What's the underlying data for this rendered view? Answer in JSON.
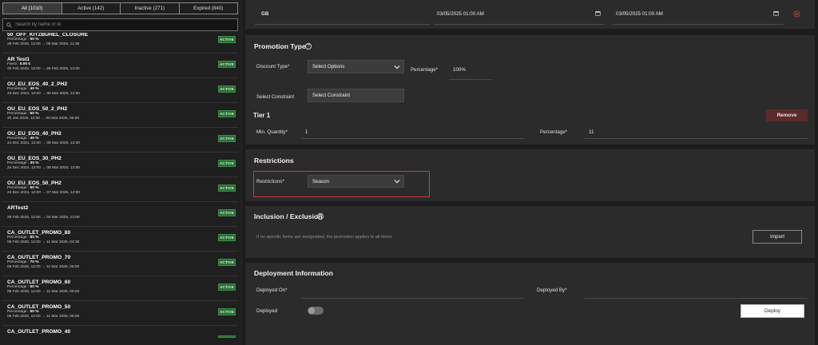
{
  "tabs": [
    {
      "label": "All (1010)"
    },
    {
      "label": "Active (142)"
    },
    {
      "label": "Inactive (271)"
    },
    {
      "label": "Expired (840)"
    }
  ],
  "search": {
    "placeholder": "Search by name or id"
  },
  "promotions": [
    {
      "name": "50_OFF_KITZBUHEL_CLOSURE",
      "type": "Percentage",
      "amount": "50 %",
      "dates": "28 Feb 2025, 12:00 → 08 Mar 2025, 11:35",
      "status": "ACTIVE"
    },
    {
      "name": "AR Test1",
      "type": "Fixed",
      "amount": "0.00 €",
      "dates": "26 Feb 2025, 12:00 → 28 Feb 2025, 12:00",
      "status": "ACTIVE"
    },
    {
      "name": "OU_EU_EOS_40_2_PH2",
      "type": "Percentage",
      "amount": "40 %",
      "dates": "24 Dec 2024, 12:00 → 06 Mar 2025, 12:00",
      "status": "ACTIVE"
    },
    {
      "name": "OU_EU_EOS_50_2_PH2",
      "type": "Percentage",
      "amount": "50 %",
      "dates": "20 Jan 2025, 12:00 → 06 Mar 2025, 06:00",
      "status": "ACTIVE"
    },
    {
      "name": "OU_EU_EOS_40_PH2",
      "type": "Percentage",
      "amount": "40 %",
      "dates": "24 Dec 2024, 12:00 → 06 Mar 2025, 12:00",
      "status": "ACTIVE"
    },
    {
      "name": "OU_EU_EOS_30_PH2",
      "type": "Percentage",
      "amount": "30 %",
      "dates": "24 Dec 2024, 12:00 → 06 Mar 2025, 12:00",
      "status": "ACTIVE"
    },
    {
      "name": "OU_EU_EOS_50_PH2",
      "type": "Percentage",
      "amount": "50 %",
      "dates": "24 Dec 2024, 12:00 → 07 Mar 2025, 12:00",
      "status": "ACTIVE"
    },
    {
      "name": "ARTest2",
      "type": "",
      "amount": "",
      "dates": "26 Feb 2025, 12:00 → 03 Mar 2025, 12:00",
      "status": "ACTIVE"
    },
    {
      "name": "CA_OUTLET_PROMO_80",
      "type": "Percentage",
      "amount": "80 %",
      "dates": "06 Feb 2025, 12:00 → 11 Mar 2025, 04:30",
      "status": "ACTIVE"
    },
    {
      "name": "CA_OUTLET_PROMO_70",
      "type": "Percentage",
      "amount": "70 %",
      "dates": "06 Feb 2025, 12:00 → 11 Mar 2025, 05:00",
      "status": "ACTIVE"
    },
    {
      "name": "CA_OUTLET_PROMO_60",
      "type": "Percentage",
      "amount": "60 %",
      "dates": "06 Feb 2025, 12:00 → 11 Mar 2025, 05:00",
      "status": "ACTIVE"
    },
    {
      "name": "CA_OUTLET_PROMO_50",
      "type": "Percentage",
      "amount": "50 %",
      "dates": "06 Feb 2025, 12:00 → 11 Mar 2025, 05:00",
      "status": "ACTIVE"
    },
    {
      "name": "CA_OUTLET_PROMO_40",
      "type": "",
      "amount": "",
      "dates": "",
      "status": ""
    }
  ],
  "schedule_row": {
    "region": "GB",
    "start": "03/05/2025 01:00 AM",
    "end": "03/05/2025 01:00 AM"
  },
  "promotion_type": {
    "title": "Promotion Type",
    "help": "?",
    "discount_type_label": "Discount Type*",
    "discount_type_value": "Select Options",
    "percentage_label": "Percentage*",
    "percentage_value": "100%",
    "constraint_label": "Select Constraint",
    "constraint_value": "Select Constraint",
    "tier_title": "Tier 1",
    "remove_label": "Remove",
    "min_qty_label": "Min. Quantity*",
    "min_qty_value": "1",
    "tier_pct_label": "Percentage*",
    "tier_pct_value": "11"
  },
  "restrictions": {
    "title": "Restrictions",
    "label": "Restrictions*",
    "value": "Season"
  },
  "inclusion": {
    "title": "Inclusion / Exclusion",
    "help": "?",
    "note": "If no specific items are designated, the promotion applies to all items",
    "import_label": "Import"
  },
  "deployment": {
    "title": "Deployment Information",
    "deployed_on_label": "Deployed On*",
    "deployed_by_label": "Deployed By*",
    "deployed_label": "Deployed",
    "deploy_button": "Deploy"
  },
  "colors": {
    "accent_red": "#d23a3a",
    "badge_green": "#2a6e35",
    "remove_button": "#5b2b2b"
  }
}
